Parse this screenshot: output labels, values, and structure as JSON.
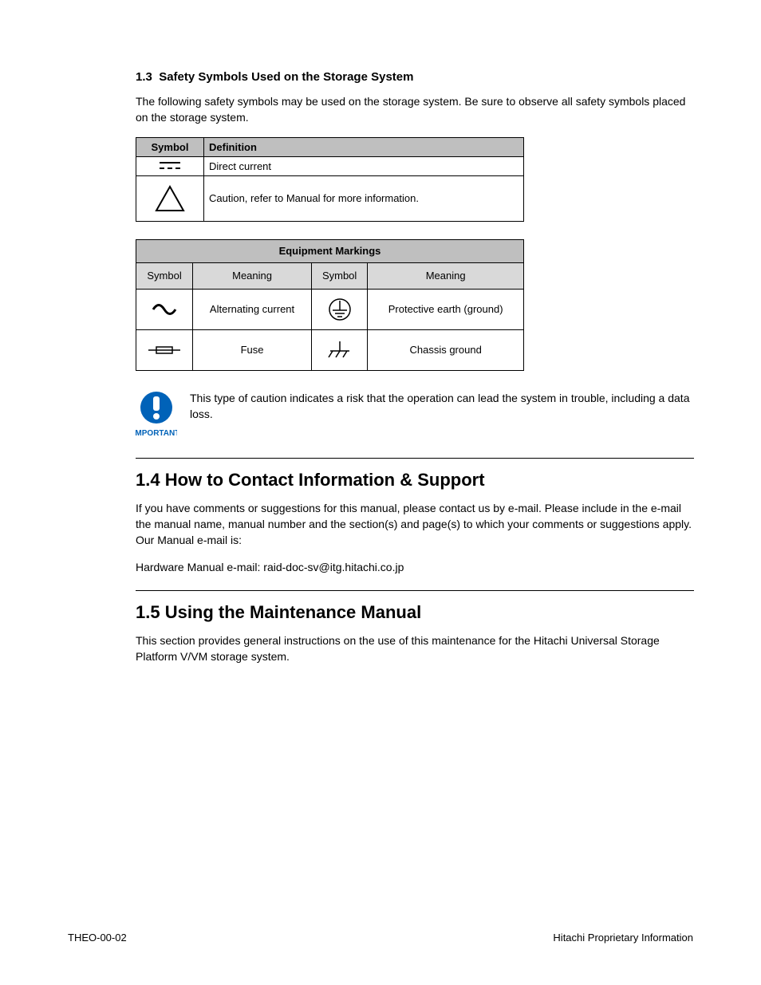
{
  "section": {
    "number": "1.3",
    "title": "Safety Symbols Used on the Storage System",
    "intro": "The following safety symbols may be used on the storage system. Be sure to observe all safety symbols placed on the storage system."
  },
  "table1": {
    "headers": [
      "Symbol",
      "Definition"
    ],
    "rows": [
      {
        "symbol": "dash",
        "definition": "Direct current"
      },
      {
        "symbol": "triangle",
        "definition": "Caution, refer to Manual for more information."
      }
    ]
  },
  "table2": {
    "title": "Equipment Markings",
    "sub_headers": [
      "Symbol",
      "Meaning",
      "Symbol",
      "Meaning"
    ],
    "rows": [
      {
        "c1_icon": "ac",
        "c1_meaning": "Alternating current",
        "c2_icon": "earth-circle",
        "c2_meaning": "Protective earth (ground)"
      },
      {
        "c1_icon": "fuse",
        "c1_meaning": "Fuse",
        "c2_icon": "chassis-ground",
        "c2_meaning": "Chassis ground"
      }
    ]
  },
  "important": "This type of caution indicates a risk that the operation can lead the system in trouble, including a data loss.",
  "contact": {
    "heading": "1.4  How to Contact Information & Support",
    "body": "If you have comments or suggestions for this manual, please contact us by e-mail. Please include in the e-mail the manual name, manual number and the section(s) and page(s) to which your comments or suggestions apply. Our Manual e-mail is:",
    "contact_label": "Hardware Manual e-mail:",
    "contact_value": "raid-doc-sv@itg.hitachi.co.jp"
  },
  "using": {
    "heading": "1.5  Using the Maintenance Manual",
    "body": "This section provides general instructions on the use of this maintenance for the Hitachi Universal Storage Platform V/VM storage system."
  },
  "footer": {
    "left": "THEO-00-02",
    "right": "Hitachi Proprietary Information"
  }
}
